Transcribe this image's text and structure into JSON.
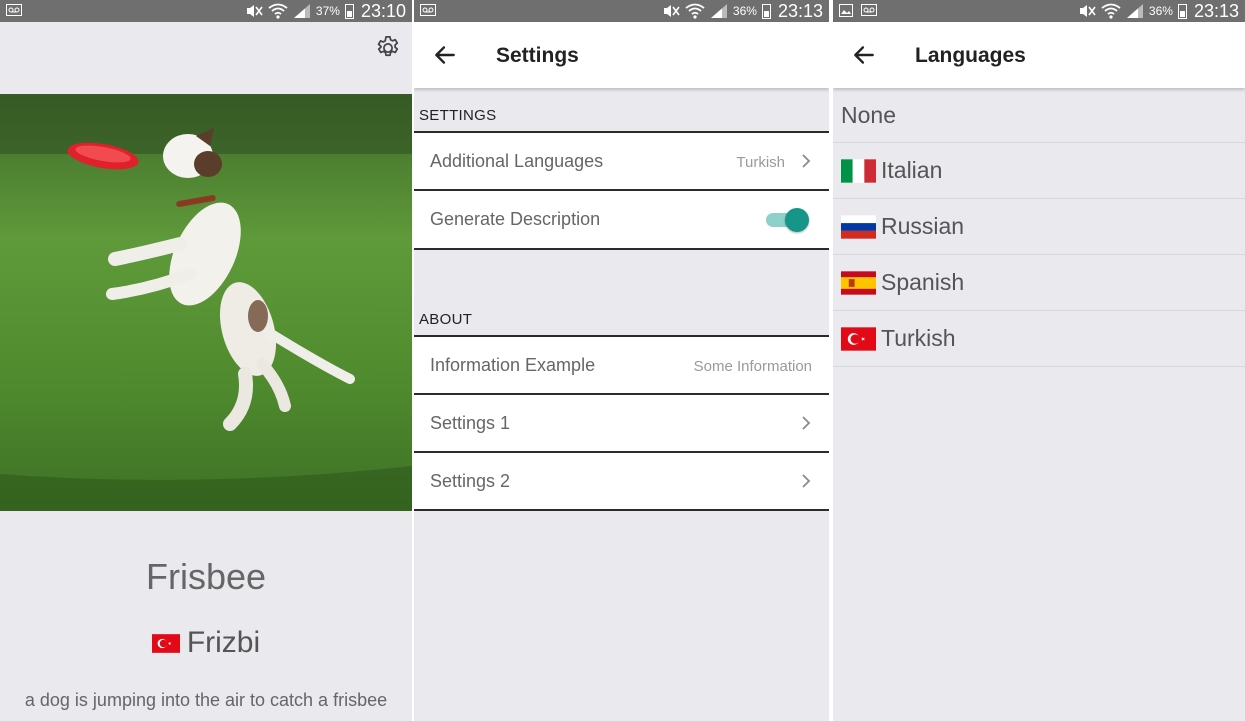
{
  "status_bars": [
    {
      "battery": "37%",
      "time": "23:10"
    },
    {
      "battery": "36%",
      "time": "23:13"
    },
    {
      "battery": "36%",
      "time": "23:13"
    }
  ],
  "result_screen": {
    "title": "Frisbee",
    "translation": "Frizbi",
    "translation_flag": "turkey-flag-icon",
    "caption": "a dog is jumping into the air to catch a frisbee",
    "settings_icon": "gear-icon"
  },
  "settings_screen": {
    "title": "Settings",
    "section_settings": "SETTINGS",
    "additional_languages_label": "Additional Languages",
    "additional_languages_value": "Turkish",
    "generate_description_label": "Generate Description",
    "generate_description_on": true,
    "section_about": "ABOUT",
    "information_label": "Information Example",
    "information_value": "Some Information",
    "settings1_label": "Settings 1",
    "settings2_label": "Settings 2",
    "toggle_color": "#159688"
  },
  "languages_screen": {
    "title": "Languages",
    "items": [
      {
        "label": "None",
        "flag": ""
      },
      {
        "label": "Italian",
        "flag": "italy-flag-icon"
      },
      {
        "label": "Russian",
        "flag": "russia-flag-icon"
      },
      {
        "label": "Spanish",
        "flag": "spain-flag-icon"
      },
      {
        "label": "Turkish",
        "flag": "turkey-flag-icon"
      }
    ]
  }
}
